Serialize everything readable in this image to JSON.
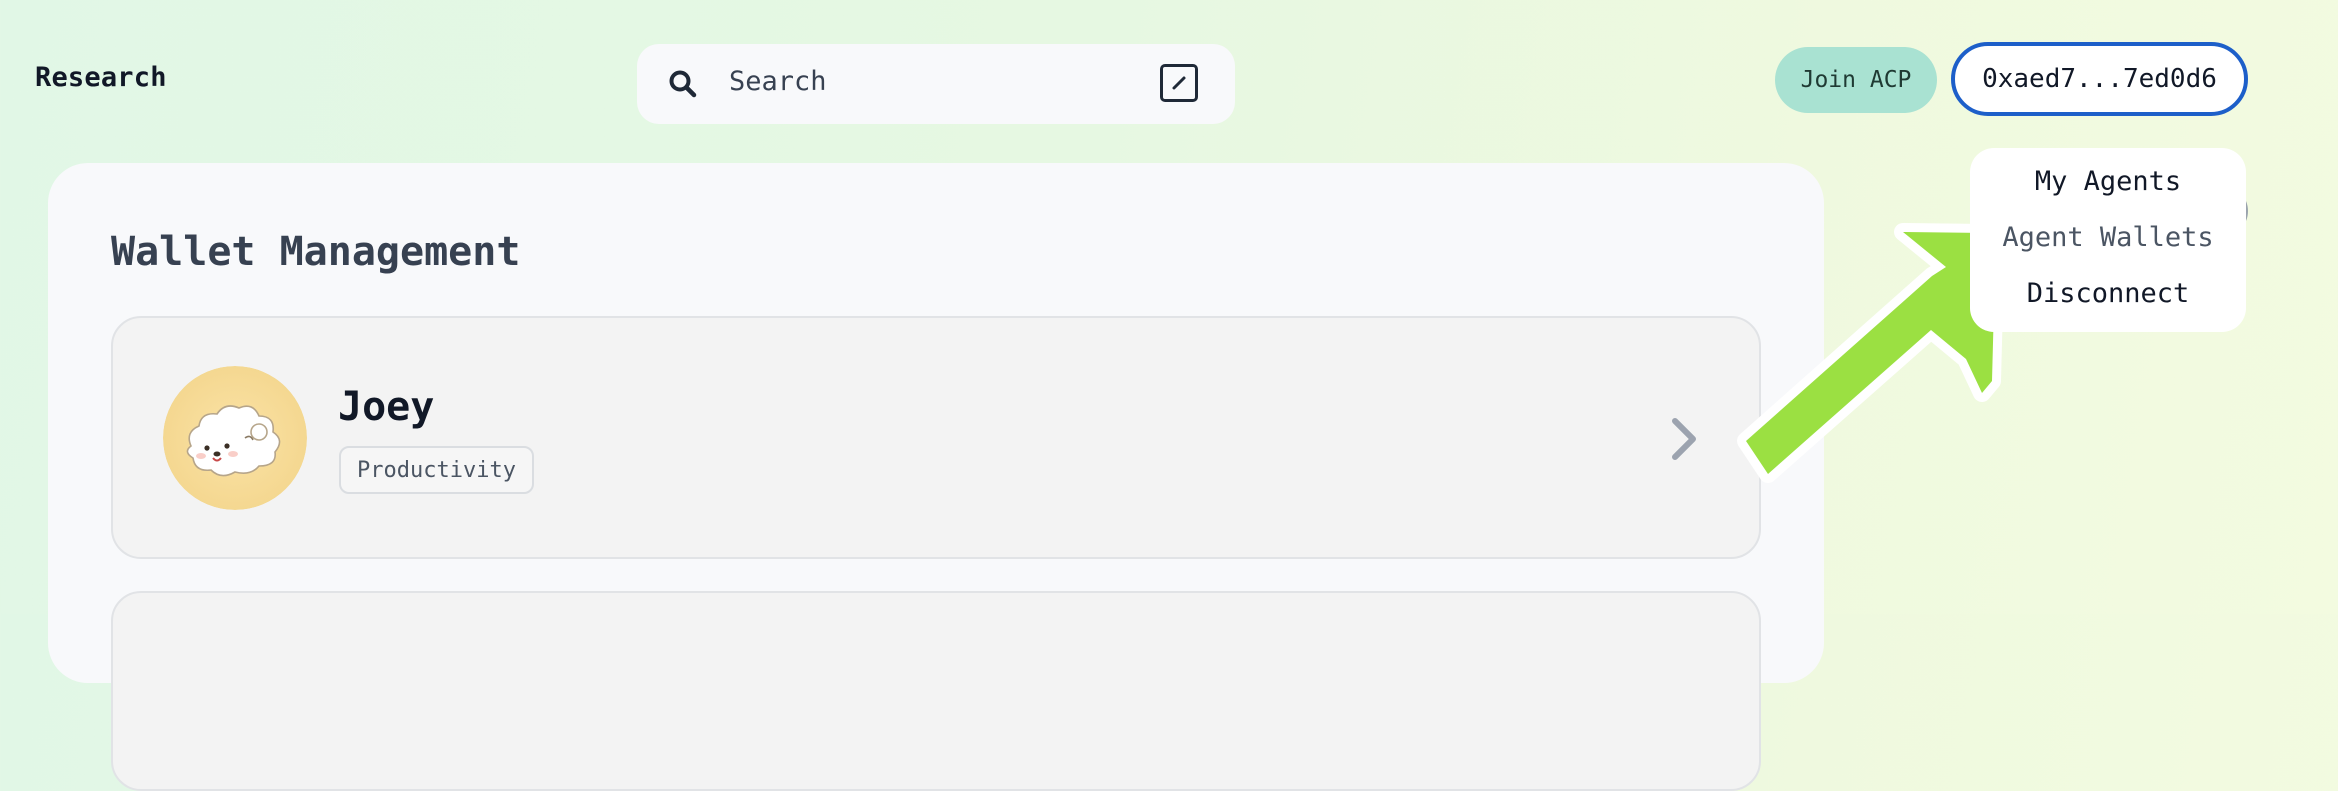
{
  "header": {
    "brand": "Research",
    "search": {
      "placeholder": "Search",
      "shortcut_icon": "slash-key-icon",
      "icon": "search-icon"
    },
    "join_label": "Join ACP",
    "wallet_label": "0xaed7...7ed0d6"
  },
  "dropdown": {
    "items": [
      "My Agents",
      "Agent Wallets",
      "Disconnect"
    ]
  },
  "main": {
    "title": "Wallet Management",
    "agents": [
      {
        "name": "Joey",
        "tag": "Productivity",
        "avatar_icon": "cloud-dog-avatar-icon"
      }
    ]
  },
  "annotation": {
    "arrow_color": "#9be042",
    "icon": "pointer-arrow-icon"
  },
  "colors": {
    "accent_border": "#1d5fc9",
    "join_bg": "#a9e2d2",
    "panel_bg": "#f8f9fb"
  }
}
